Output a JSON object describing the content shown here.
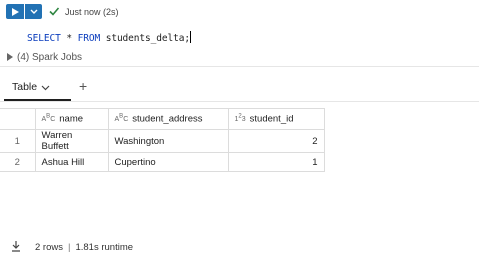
{
  "toolbar": {
    "run_icon": "play-icon",
    "dropdown_icon": "chevron-down-icon",
    "status_icon": "check-icon",
    "status_text": "Just now (2s)"
  },
  "code": {
    "kw1": "SELECT",
    "star": "*",
    "kw2": "FROM",
    "table": "students_delta;"
  },
  "spark_jobs": {
    "label": "(4) Spark Jobs"
  },
  "tabs": {
    "active_label": "Table",
    "add_icon": "+"
  },
  "table": {
    "columns": [
      {
        "type_icon": "ABC",
        "label": "name"
      },
      {
        "type_icon": "ABC",
        "label": "student_address"
      },
      {
        "type_icon": "123",
        "label": "student_id"
      }
    ],
    "rows": [
      {
        "index": "1",
        "name": "Warren Buffett",
        "student_address": "Washington",
        "student_id": "2"
      },
      {
        "index": "2",
        "name": "Ashua Hill",
        "student_address": "Cupertino",
        "student_id": "1"
      }
    ]
  },
  "footer": {
    "rows_text": "2 rows",
    "runtime_text": "1.81s runtime",
    "download_icon": "download-icon"
  },
  "colors": {
    "accent": "#2272b4",
    "success": "#2e8540"
  }
}
